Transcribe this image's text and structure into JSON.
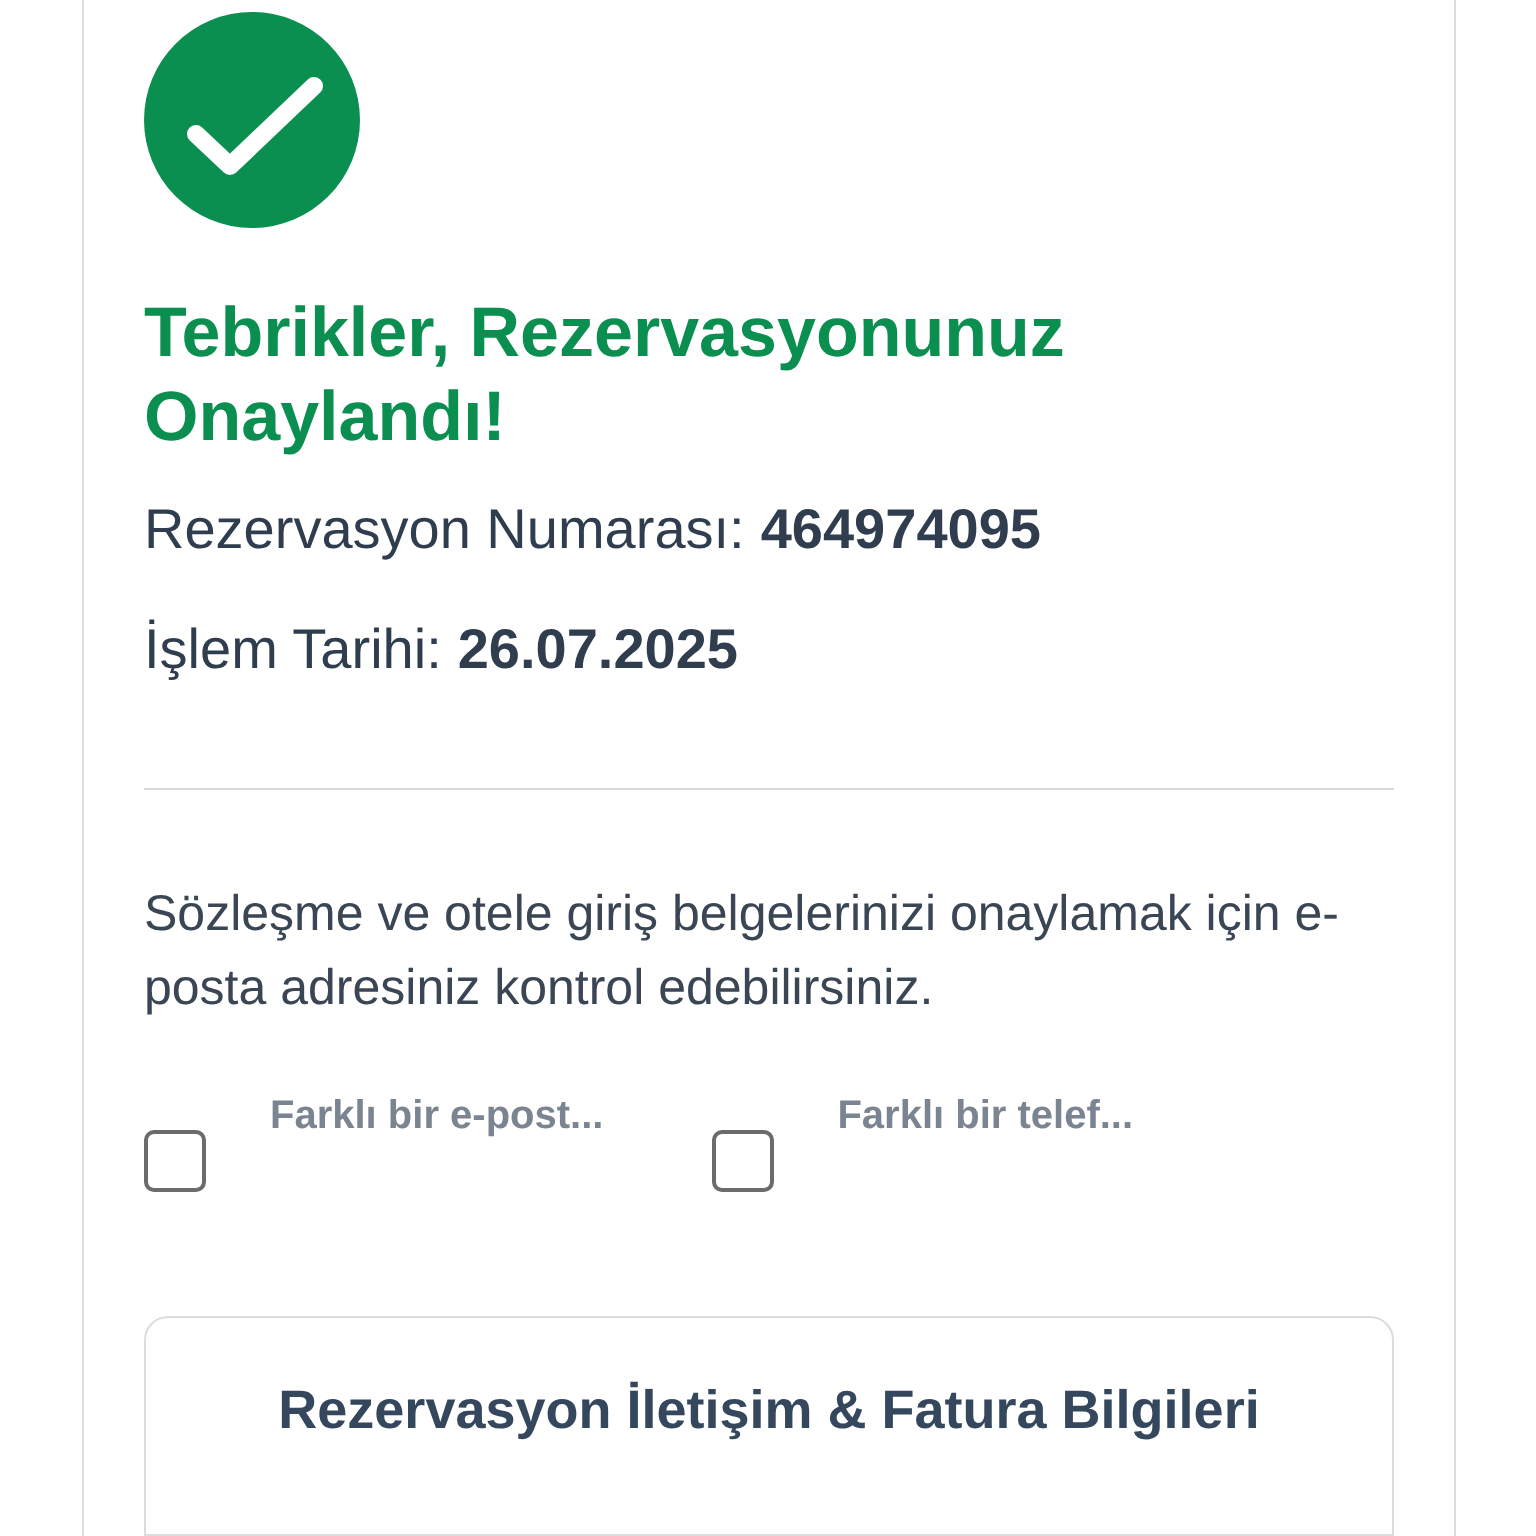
{
  "title": "Tebrikler, Rezervasyonunuz Onaylandı!",
  "details": [
    {
      "label": "Rezervasyon Numarası:",
      "value": "464974095"
    },
    {
      "label": "İşlem Tarihi:",
      "value": "26.07.2025"
    }
  ],
  "message": "Sözleşme ve otele giriş belgelerinizi onaylamak için e-posta adresiniz kontrol edebilirsiniz.",
  "options": [
    {
      "label": "Farklı bir e-post...",
      "checked": false
    },
    {
      "label": "Farklı bir telef...",
      "checked": false
    }
  ],
  "section": {
    "title": "Rezervasyon İletişim & Fatura Bilgileri"
  }
}
